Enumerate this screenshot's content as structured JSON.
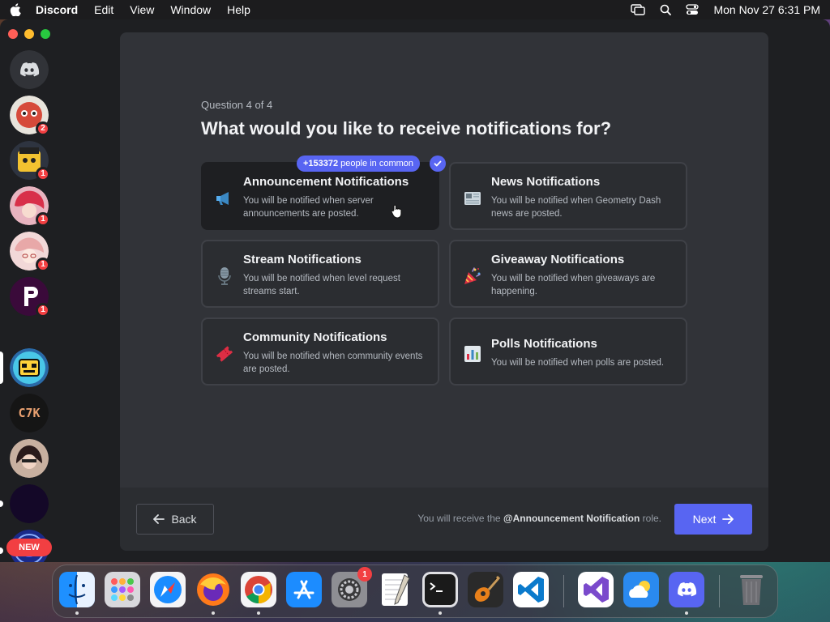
{
  "menubar": {
    "app_name": "Discord",
    "items": [
      "Edit",
      "View",
      "Window",
      "Help"
    ],
    "clock": "Mon Nov 27  6:31 PM"
  },
  "servers": [
    {
      "name": "direct-messages",
      "badge": null
    },
    {
      "name": "server-1",
      "badge": "2"
    },
    {
      "name": "server-2",
      "badge": "1"
    },
    {
      "name": "server-3",
      "badge": "1"
    },
    {
      "name": "server-4",
      "badge": "1"
    },
    {
      "name": "server-5",
      "badge": "1"
    },
    {
      "name": "geometry-dash",
      "badge": null
    },
    {
      "name": "server-c7k",
      "badge": null,
      "label": "C7K"
    },
    {
      "name": "server-8",
      "badge": null
    },
    {
      "name": "server-9",
      "badge": null
    },
    {
      "name": "server-10",
      "badge": null
    }
  ],
  "new_badge": "NEW",
  "onboarding": {
    "counter": "Question 4 of 4",
    "title": "What would you like to receive notifications for?",
    "common_count": "+153372",
    "common_text": "people in common",
    "options": [
      {
        "title": "Announcement Notifications",
        "desc": "You will be notified when server announcements are posted.",
        "icon": "megaphone-icon",
        "selected": true
      },
      {
        "title": "News Notifications",
        "desc": "You will be notified when Geometry Dash news are posted.",
        "icon": "newspaper-icon",
        "selected": false
      },
      {
        "title": "Stream Notifications",
        "desc": "You will be notified when level request streams start.",
        "icon": "microphone-icon",
        "selected": false
      },
      {
        "title": "Giveaway Notifications",
        "desc": "You will be notified when giveaways are happening.",
        "icon": "party-popper-icon",
        "selected": false
      },
      {
        "title": "Community Notifications",
        "desc": "You will be notified when community events are posted.",
        "icon": "ticket-icon",
        "selected": false
      },
      {
        "title": "Polls Notifications",
        "desc": "You will be notified when polls are posted.",
        "icon": "bar-chart-icon",
        "selected": false
      }
    ],
    "footer": {
      "back_label": "Back",
      "note_prefix": "You will receive the",
      "note_role": "@Announcement Notification",
      "note_suffix": "role.",
      "next_label": "Next"
    }
  },
  "dock": {
    "apps": [
      "finder",
      "launchpad",
      "safari",
      "firefox",
      "chrome",
      "app-store",
      "system-settings",
      "textedit",
      "terminal",
      "garageband",
      "vscode",
      "visual-studio",
      "weather",
      "discord",
      "trash"
    ],
    "system_settings_badge": "1"
  },
  "colors": {
    "blurple": "#5865f2",
    "modal_bg": "#313338",
    "footer_bg": "#2b2d31",
    "badge_red": "#f23f42"
  }
}
